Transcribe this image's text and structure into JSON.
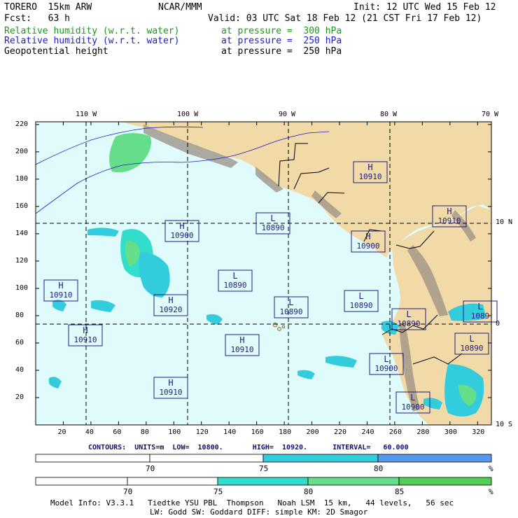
{
  "header": {
    "model": "TORERO  15km ARW",
    "center": "NCAR/MMM",
    "init": "Init: 12 UTC Wed 15 Feb 12",
    "fcst": "Fcst:   63 h",
    "valid": "Valid: 03 UTC Sat 18 Feb 12 (21 CST Fri 17 Feb 12)",
    "fields": [
      {
        "name": "Relative humidity (w.r.t. water)",
        "level": "at pressure =  300 hPa",
        "color": "#1a9a1a"
      },
      {
        "name": "Relative humidity (w.r.t. water)",
        "level": "at pressure =  250 hPa",
        "color": "#1c1ccc"
      },
      {
        "name": "Geopotential height",
        "level": "at pressure =  250 hPa",
        "color": "#000000"
      }
    ]
  },
  "map": {
    "ocean_color": "#e0fbfb",
    "land_color": "#f2d9a8",
    "mountain_color": "#9a8f84",
    "lon_labels": [
      "110 W",
      "100 W",
      "90 W",
      "80 W",
      "70 W"
    ],
    "lat_labels": [
      "10 N",
      "0",
      "10 S"
    ],
    "x_ticks": [
      "20",
      "40",
      "60",
      "80",
      "100",
      "120",
      "140",
      "160",
      "180",
      "200",
      "220",
      "240",
      "260",
      "280",
      "300",
      "320"
    ],
    "y_ticks": [
      "220",
      "200",
      "180",
      "160",
      "140",
      "120",
      "100",
      "80",
      "60",
      "40",
      "20"
    ],
    "centers": [
      {
        "type": "H",
        "value": "10910"
      },
      {
        "type": "H",
        "value": "10900"
      },
      {
        "type": "L",
        "value": "10890"
      },
      {
        "type": "H",
        "value": "10900"
      },
      {
        "type": "H",
        "value": "10910"
      },
      {
        "type": "H",
        "value": "10910"
      },
      {
        "type": "L",
        "value": "10890"
      },
      {
        "type": "H",
        "value": "10920"
      },
      {
        "type": "L",
        "value": "10890"
      },
      {
        "type": "L",
        "value": "10890"
      },
      {
        "type": "L",
        "value": "1089"
      },
      {
        "type": "L",
        "value": "10890"
      },
      {
        "type": "H",
        "value": "10910"
      },
      {
        "type": "L",
        "value": "10890"
      },
      {
        "type": "H",
        "value": "10910"
      },
      {
        "type": "H",
        "value": "10910"
      },
      {
        "type": "L",
        "value": "10900"
      },
      {
        "type": "L",
        "value": "10900"
      }
    ]
  },
  "contours": {
    "text": "CONTOURS:  UNITS=m  LOW=  10800.       HIGH=  10920.      INTERVAL=   60.000"
  },
  "colorbar1": {
    "labels": [
      "70",
      "75",
      "80",
      "%"
    ],
    "colors": [
      "#ffffff",
      "#ffffff",
      "#33ccdd",
      "#5599ee"
    ]
  },
  "colorbar2": {
    "labels": [
      "70",
      "75",
      "80",
      "85",
      "%"
    ],
    "colors": [
      "#ffffff",
      "#ffffff",
      "#33ddcc",
      "#66dd88",
      "#55cc55"
    ]
  },
  "footer": {
    "line1": "Model Info: V3.3.1   Tiedtke YSU PBL  Thompson   Noah LSM  15 km,   44 levels,   56 sec",
    "line2": "LW: Godd SW: Goddard DIFF: simple KM: 2D Smagor"
  }
}
